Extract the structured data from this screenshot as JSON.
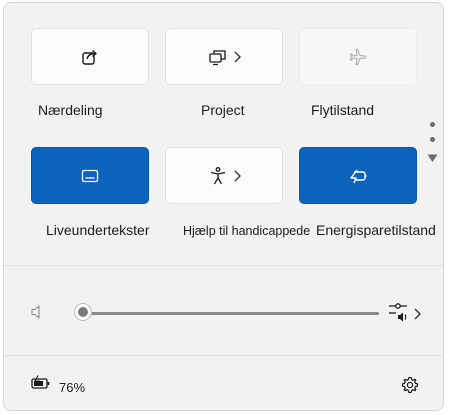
{
  "tiles": [
    {
      "label": "Nærdeling",
      "icon": "share-icon",
      "state": "off"
    },
    {
      "label": "Project",
      "icon": "project-icon",
      "state": "off",
      "has_submenu": true
    },
    {
      "label": "Flytilstand",
      "icon": "airplane-icon",
      "state": "disabled"
    },
    {
      "label": "Liveundertekster",
      "icon": "captions-icon",
      "state": "on"
    },
    {
      "label": "Hjælp til handicappede",
      "icon": "accessibility-icon",
      "state": "off",
      "has_submenu": true
    },
    {
      "label": "Energisparetilstand",
      "icon": "battery-saver-icon",
      "state": "on"
    }
  ],
  "volume": {
    "level": 0,
    "icon": "speaker-muted-icon",
    "output_icon": "audio-output-icon"
  },
  "footer": {
    "battery_percent": "76%",
    "battery_icon": "battery-charging-icon",
    "settings_icon": "gear-icon"
  },
  "colors": {
    "accent": "#0c63bb",
    "panel_bg": "#f2f2f2"
  }
}
